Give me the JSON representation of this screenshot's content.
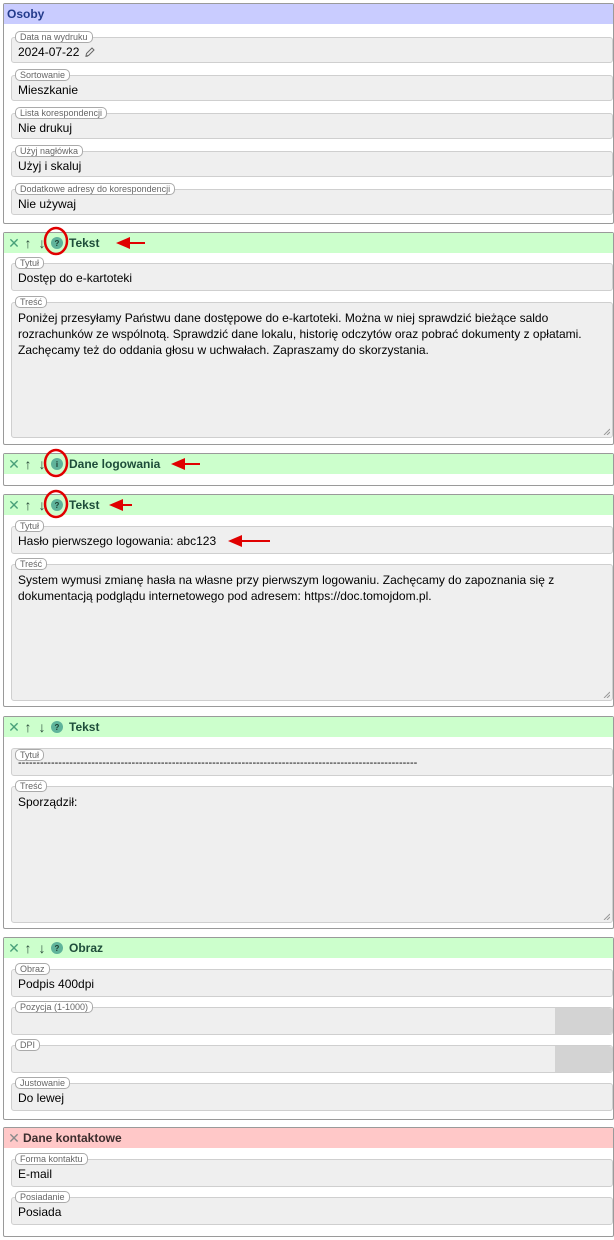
{
  "colors": {
    "section_blue": "#c9ccff",
    "section_green": "#ccffcc",
    "section_red": "#ffc8c8",
    "annotation_red": "#e00000"
  },
  "osoby": {
    "title": "Osoby",
    "fields": [
      {
        "label": "Data na wydruku",
        "value": "2024-07-22"
      },
      {
        "label": "Sortowanie",
        "value": "Mieszkanie"
      },
      {
        "label": "Lista korespondencji",
        "value": "Nie drukuj"
      },
      {
        "label": "Użyj nagłówka",
        "value": "Użyj i skaluj"
      },
      {
        "label": "Dodatkowe adresy do korespondencji",
        "value": "Nie używaj"
      }
    ]
  },
  "block_controls": {
    "remove_icon": "close-icon",
    "up_icon": "arrow-up-icon",
    "down_icon": "arrow-down-icon",
    "help_icon": "help-icon"
  },
  "blocks": [
    {
      "title": "Tekst",
      "title_label": "Tytuł",
      "title_value": "Dostęp do e-kartoteki",
      "body_label": "Treść",
      "body_value": "Poniżej przesyłamy Państwu dane dostępowe do e-kartoteki. Można w niej sprawdzić bieżące saldo rozrachunków ze wspólnotą. Sprawdzić dane lokalu, historię odczytów oraz pobrać dokumenty z opłatami. Zachęcamy też do oddania głosu w uchwałach. Zapraszamy do skorzystania."
    },
    {
      "title": "Dane logowania"
    },
    {
      "title": "Tekst",
      "title_label": "Tytuł",
      "title_value": "Hasło pierwszego logowania: abc123",
      "body_label": "Treść",
      "body_value": "System wymusi zmianę hasła na własne przy pierwszym logowaniu. Zachęcamy do zapoznania się z dokumentacją podglądu internetowego pod adresem: https://doc.tomojdom.pl."
    },
    {
      "title": "Tekst",
      "title_label": "Tytuł",
      "title_value": "-------------------------------------------------------------------------------------------------------------",
      "body_label": "Treść",
      "body_value": "Sporządził:"
    },
    {
      "title": "Obraz",
      "fields": [
        {
          "label": "Obraz",
          "value": "Podpis 400dpi"
        },
        {
          "label": "Pozycja (1-1000)",
          "value": ""
        },
        {
          "label": "DPI",
          "value": ""
        },
        {
          "label": "Justowanie",
          "value": "Do lewej"
        }
      ]
    }
  ],
  "kontakt": {
    "title": "Dane kontaktowe",
    "fields": [
      {
        "label": "Forma kontaktu",
        "value": "E-mail"
      },
      {
        "label": "Posiadanie",
        "value": "Posiada"
      }
    ]
  }
}
